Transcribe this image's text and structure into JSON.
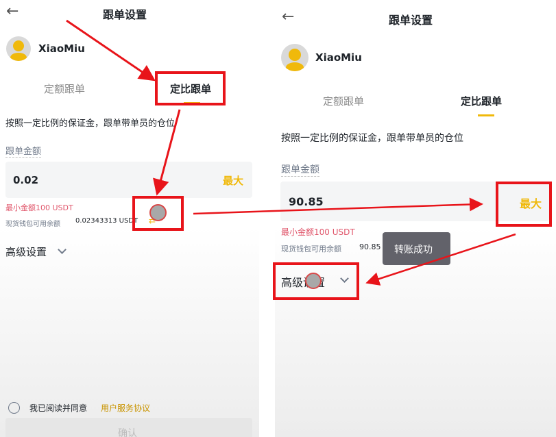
{
  "left": {
    "title": "跟单设置",
    "username": "XiaoMiu",
    "tabs": [
      "定额跟单",
      "定比跟单"
    ],
    "description": "按照一定比例的保证金，跟单带单员的仓位",
    "amount_label": "跟单金额",
    "amount_value": "0.02",
    "max_label": "最大",
    "min_amount": "最小金额100 USDT",
    "balance_label": "现货钱包可用余额",
    "balance_value": "0.02343313 USDT",
    "advanced": "高级设置",
    "agree_text": "我已阅读并同意",
    "agree_link": "用户服务协议",
    "confirm": "确认"
  },
  "right": {
    "title": "跟单设置",
    "username": "XiaoMiu",
    "tabs": [
      "定额跟单",
      "定比跟单"
    ],
    "description": "按照一定比例的保证金，跟单带单员的仓位",
    "amount_label": "跟单金额",
    "amount_value": "90.85",
    "max_label": "最大",
    "min_amount": "最小金额100 USDT",
    "balance_label": "现货钱包可用余额",
    "balance_value": "90.85",
    "toast": "转账成功",
    "advanced": "高级设置"
  },
  "colors": {
    "accent": "#f0b90b",
    "annotation_red": "#e8141a",
    "warning_text": "#e0566b"
  },
  "icons": [
    "back-arrow-icon",
    "avatar-icon",
    "chevron-down-icon",
    "transfer-icon",
    "radio-icon"
  ]
}
